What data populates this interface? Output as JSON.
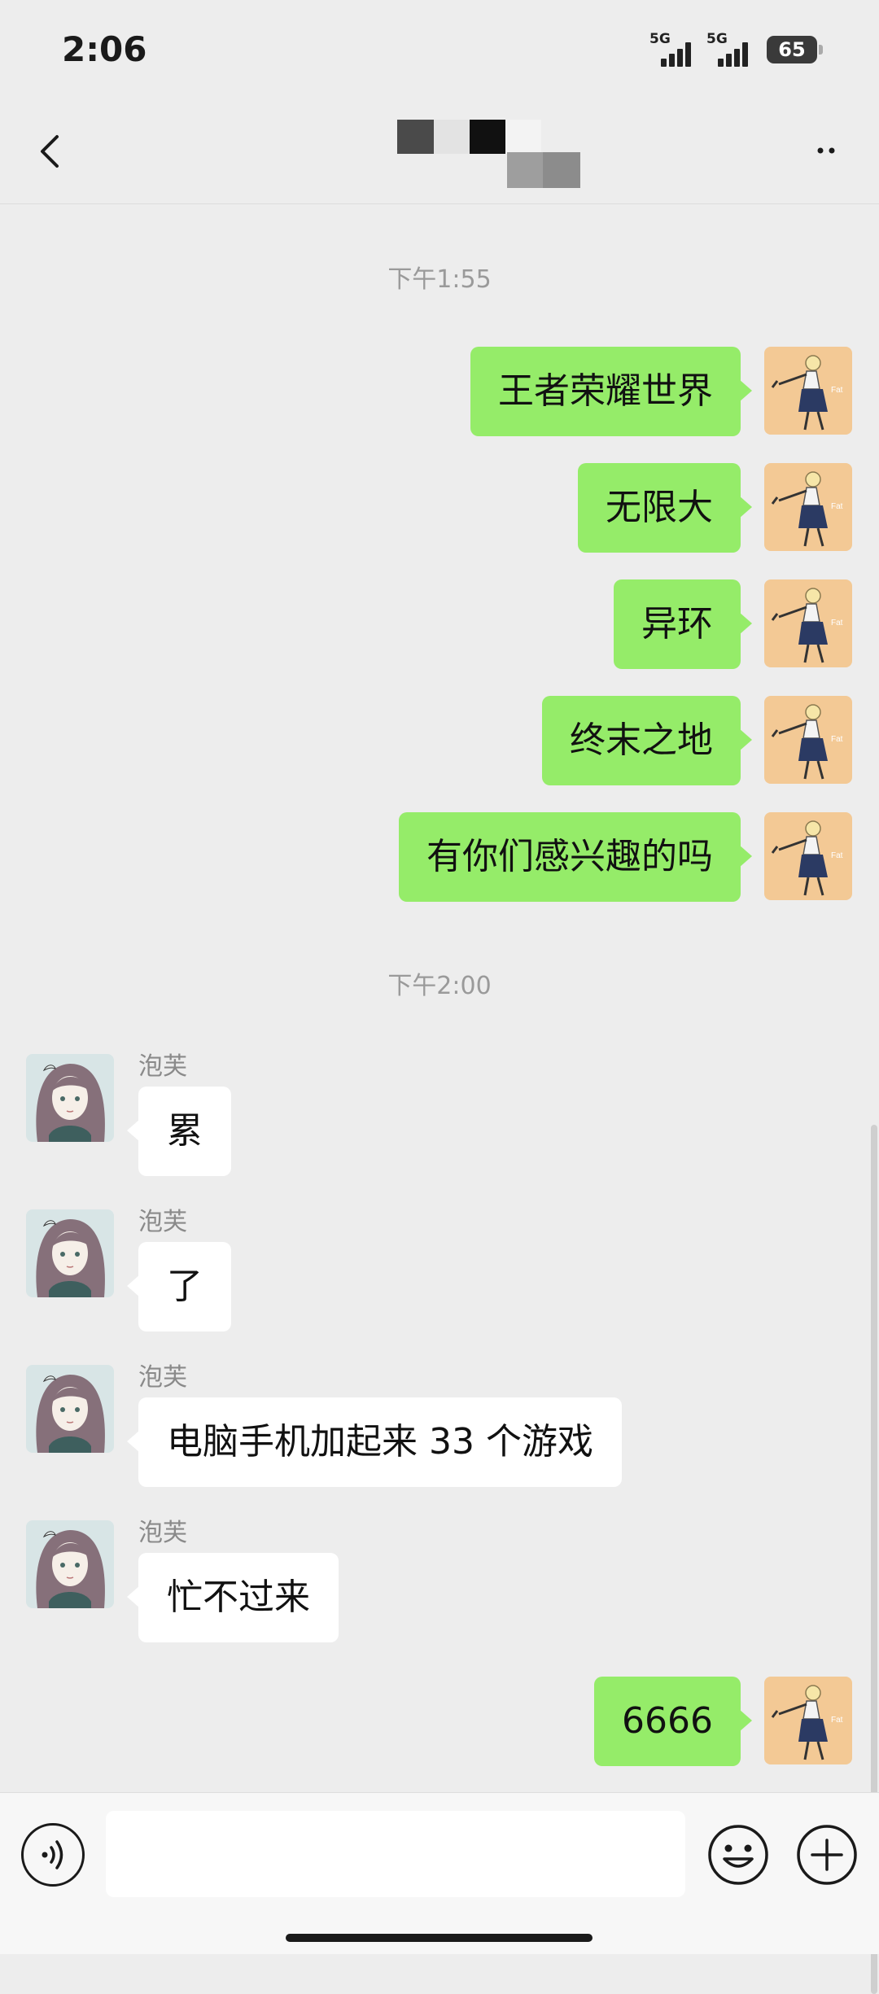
{
  "status_bar": {
    "time": "2:06",
    "signal_1_label": "5G",
    "signal_2_label": "5G",
    "battery": "65"
  },
  "nav": {
    "back_icon": "chevron-left-icon",
    "more_icon": "more-dots-icon"
  },
  "chat": {
    "timestamp_1": "下午1:55",
    "outgoing_1": "王者荣耀世界",
    "outgoing_2": "无限大",
    "outgoing_3": "异环",
    "outgoing_4": "终末之地",
    "outgoing_5": "有你们感兴趣的吗",
    "timestamp_2": "下午2:00",
    "incoming": [
      {
        "sender": "泡芙",
        "text": "累"
      },
      {
        "sender": "泡芙",
        "text": "了"
      },
      {
        "sender": "泡芙",
        "text": "电脑手机加起来 33 个游戏"
      },
      {
        "sender": "泡芙",
        "text": "忙不过来"
      }
    ],
    "outgoing_6": "6666"
  },
  "input_bar": {
    "voice_icon": "voice-icon",
    "message_value": "",
    "emoji_icon": "emoji-icon",
    "plus_icon": "plus-icon"
  },
  "colors": {
    "background": "#ededed",
    "outgoing_bubble": "#95ec69",
    "incoming_bubble": "#ffffff",
    "timestamp_text": "#9a9a9a"
  }
}
